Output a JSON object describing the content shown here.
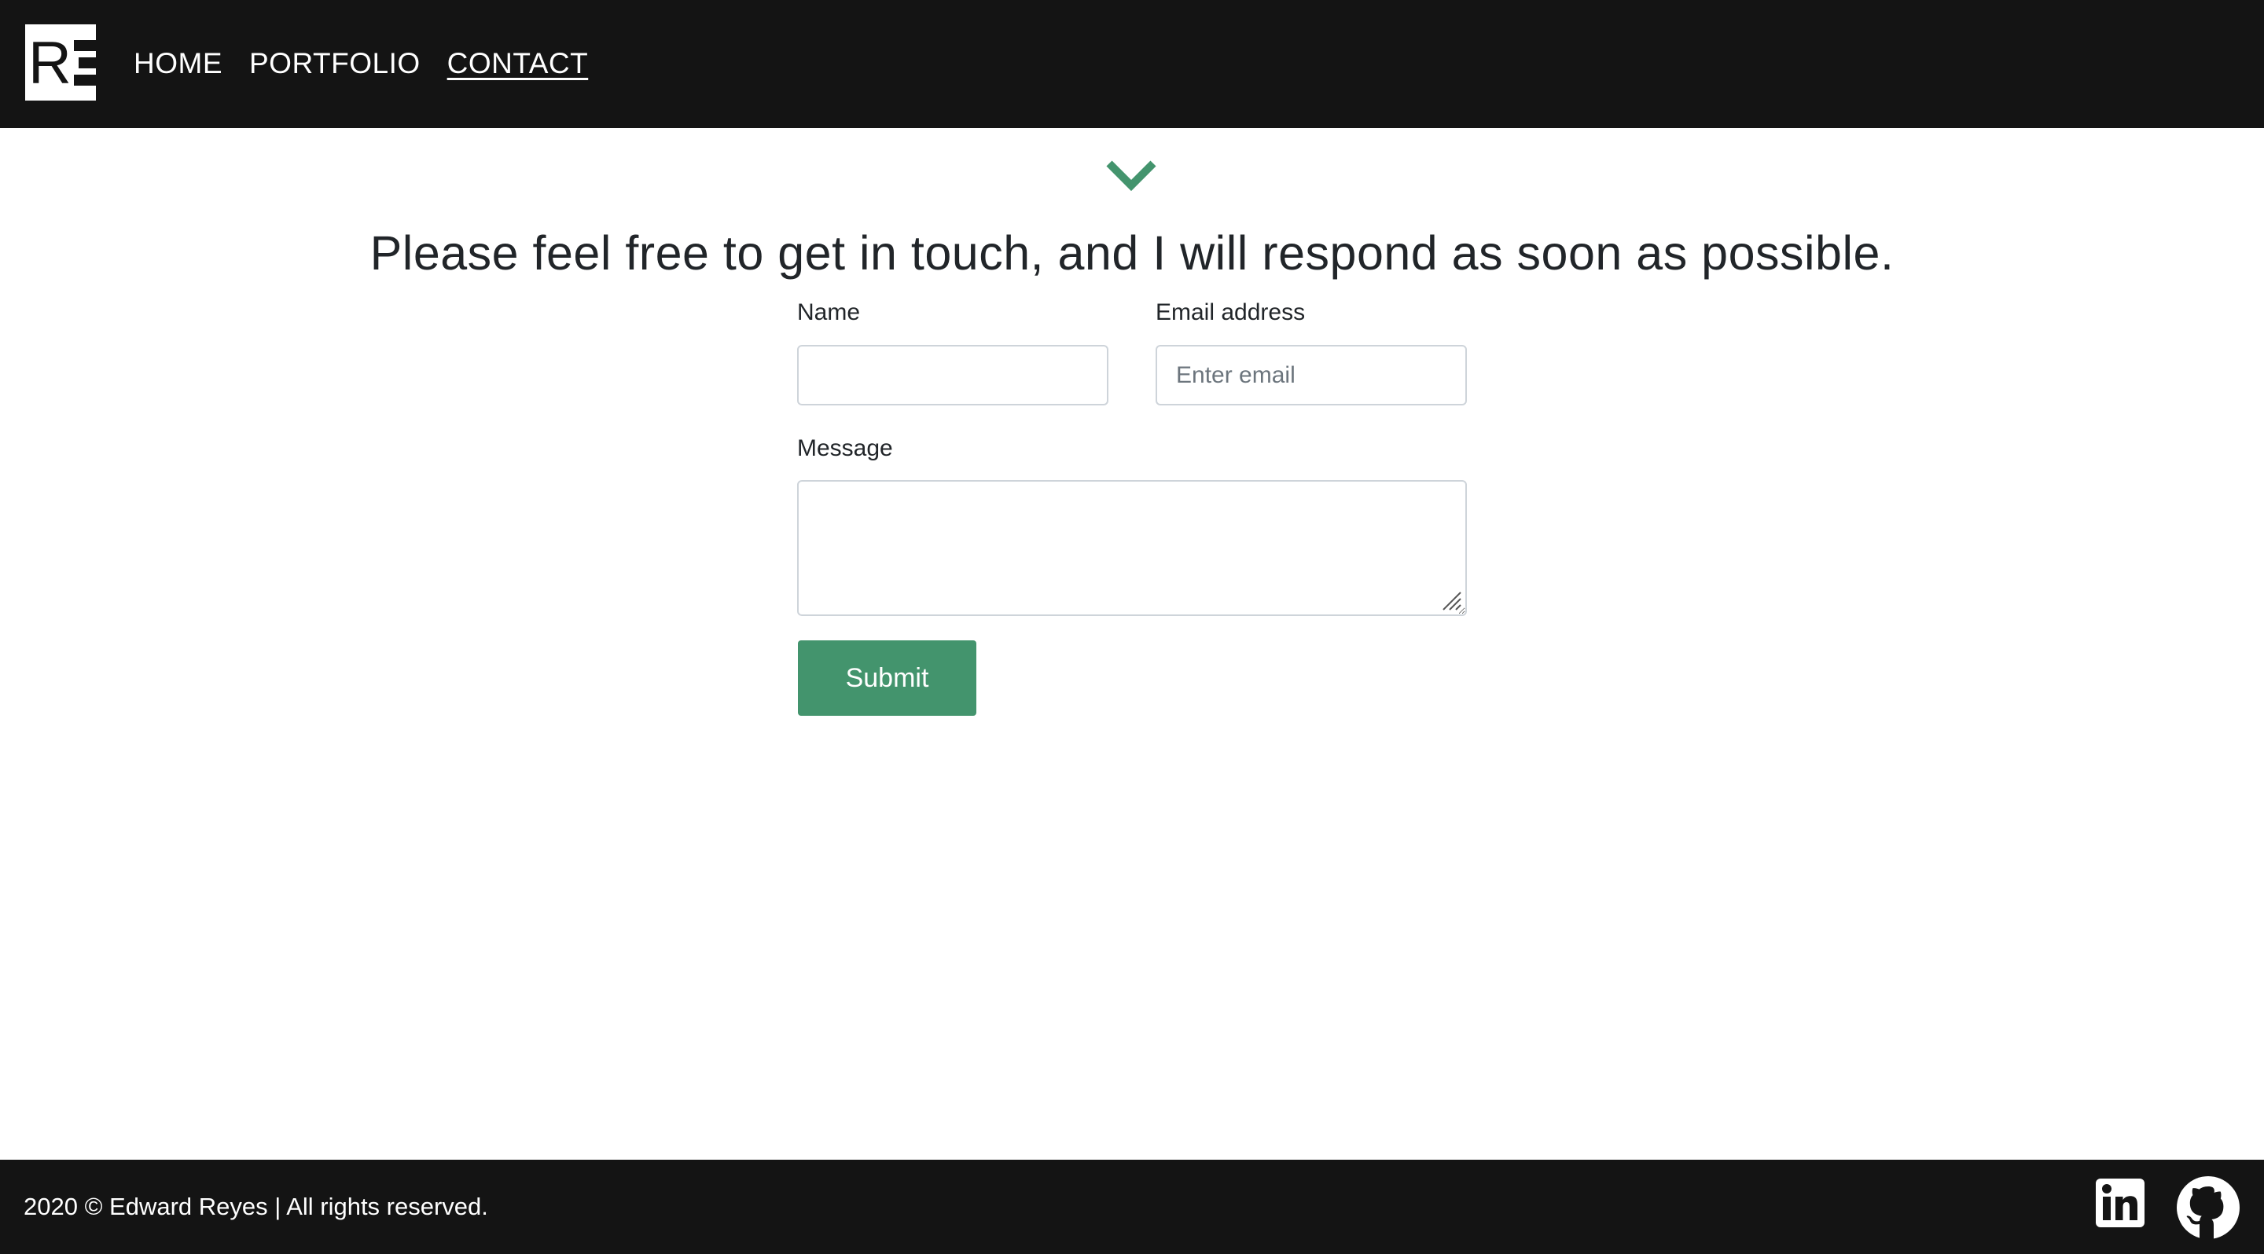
{
  "nav": {
    "logo_text": "RE",
    "links": [
      {
        "label": "HOME"
      },
      {
        "label": "PORTFOLIO"
      },
      {
        "label": "CONTACT"
      }
    ]
  },
  "main": {
    "scroll_icon": "chevron-down-icon",
    "headline": "Please feel free to get in touch, and I will respond as soon as possible.",
    "form": {
      "name_label": "Name",
      "name_value": "",
      "email_label": "Email address",
      "email_placeholder": "Enter email",
      "message_label": "Message",
      "message_value": "",
      "submit_label": "Submit"
    }
  },
  "footer": {
    "copyright": "2020 © Edward Reyes | All rights reserved.",
    "social": [
      {
        "icon": "linkedin-icon"
      },
      {
        "icon": "github-icon"
      }
    ]
  },
  "colors": {
    "nav_bg": "#141414",
    "accent": "#43946d",
    "text": "#212529"
  }
}
